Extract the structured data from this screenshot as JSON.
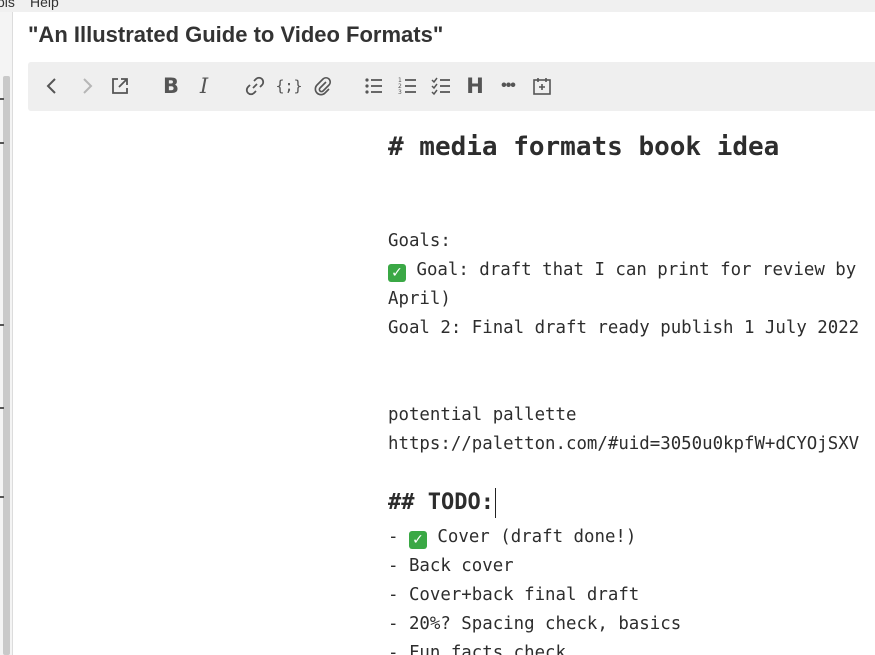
{
  "menubar": {
    "items": [
      "ols",
      "Help"
    ]
  },
  "note": {
    "title": "\"An Illustrated Guide to Video Formats\""
  },
  "toolbar": {
    "buttons": [
      {
        "name": "back-icon"
      },
      {
        "name": "forward-icon"
      },
      {
        "name": "open-external-icon"
      },
      {
        "name": "bold-icon",
        "text": "B"
      },
      {
        "name": "italic-icon",
        "text": "I"
      },
      {
        "name": "link-icon"
      },
      {
        "name": "code-icon",
        "text": "{;}"
      },
      {
        "name": "attachment-icon"
      },
      {
        "name": "bullet-list-icon"
      },
      {
        "name": "numbered-list-icon"
      },
      {
        "name": "checklist-icon"
      },
      {
        "name": "heading-icon",
        "text": "H"
      },
      {
        "name": "more-icon",
        "text": "•••"
      },
      {
        "name": "insert-date-icon"
      }
    ]
  },
  "editor": {
    "heading1": "# media formats book idea",
    "goals_label": "Goals:",
    "goal1_line1": " Goal: draft that I can print for review by",
    "goal1_line2": "April)",
    "goal2": "Goal 2: Final draft ready publish 1 July 2022",
    "palette_label": "potential pallette",
    "palette_url": "https://paletton.com/#uid=3050u0kpfW+dCYOjSXV",
    "todo_heading": "## TODO:",
    "todo_items": [
      "- ",
      " Cover (draft done!)",
      "- Back cover",
      "- Cover+back final draft",
      "- 20%? Spacing check, basics",
      "- Fun facts check"
    ]
  },
  "colors": {
    "check_green": "#3aa845",
    "toolbar_bg": "#efefef"
  }
}
